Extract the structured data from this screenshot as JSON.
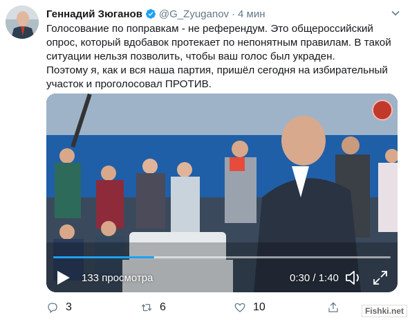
{
  "author": {
    "name": "Геннадий Зюганов",
    "handle": "@G_Zyuganov",
    "separator": "·",
    "time": "4 мин"
  },
  "tweet": {
    "paragraphs": [
      "Голосование по поправкам - не референдум. Это общероссийский опрос, который вдобавок протекает по непонятным правилам. В такой ситуации нельзя позволить, чтобы ваш голос был украден.",
      "Поэтому я, как и вся наша партия, пришёл сегодня на избирательный участок и проголосовал ПРОТИВ."
    ]
  },
  "video": {
    "views": "133 просмотра",
    "timer": "0:30 / 1:40",
    "progress_fraction": 0.3
  },
  "actions": {
    "replies": "3",
    "retweets": "6",
    "likes": "10"
  },
  "watermark": {
    "left": "Fishki",
    "sep": ".",
    "right": "net"
  },
  "colors": {
    "accent": "#1da1f2",
    "text": "#14171a",
    "muted": "#657786"
  },
  "icons": [
    "verified-icon",
    "chevron-down-icon",
    "play-icon",
    "volume-icon",
    "fullscreen-icon",
    "reply-icon",
    "retweet-icon",
    "like-icon",
    "share-icon"
  ]
}
